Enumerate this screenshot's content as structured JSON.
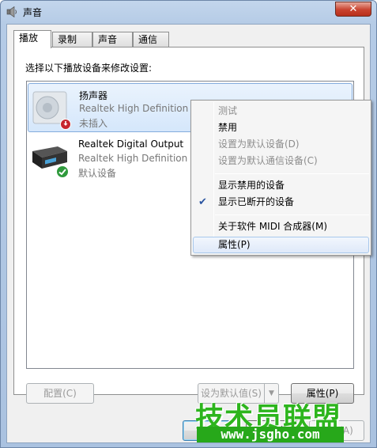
{
  "window": {
    "title": "声音",
    "close_glyph": "✕"
  },
  "tabs": [
    {
      "label": "播放",
      "active": true
    },
    {
      "label": "录制",
      "active": false
    },
    {
      "label": "声音",
      "active": false
    },
    {
      "label": "通信",
      "active": false
    }
  ],
  "panel": {
    "instruction": "选择以下播放设备来修改设置:"
  },
  "devices": [
    {
      "name": "扬声器",
      "description": "Realtek High Definition Audio",
      "status": "未插入",
      "icon": "speaker-icon",
      "badge": "unplugged-badge-icon",
      "selected": true
    },
    {
      "name": "Realtek Digital Output",
      "description": "Realtek High Definition Audio",
      "status": "默认设备",
      "icon": "digital-output-icon",
      "badge": "default-check-icon",
      "selected": false
    }
  ],
  "buttons": {
    "configure": "配置(C)",
    "set_default": "设为默认值(S)",
    "properties": "属性(P)",
    "ok": "确定",
    "cancel": "取消",
    "apply": "应用(A)"
  },
  "context_menu": {
    "items": [
      {
        "label": "测试",
        "enabled": false
      },
      {
        "label": "禁用",
        "enabled": true
      },
      {
        "label": "设置为默认设备(D)",
        "enabled": false
      },
      {
        "label": "设置为默认通信设备(C)",
        "enabled": false
      },
      {
        "label": "显示禁用的设备",
        "enabled": true
      },
      {
        "label": "显示已断开的设备",
        "enabled": true,
        "checked": true
      },
      {
        "label": "关于软件 MIDI 合成器(M)",
        "enabled": true
      },
      {
        "label": "属性(P)",
        "enabled": true,
        "highlighted": true
      }
    ]
  },
  "watermark": {
    "logo_text": "技术员联盟",
    "url": "www.jsgho.com"
  },
  "colors": {
    "accent": "#3c7fb1",
    "watermark_green": "#2db51d"
  }
}
